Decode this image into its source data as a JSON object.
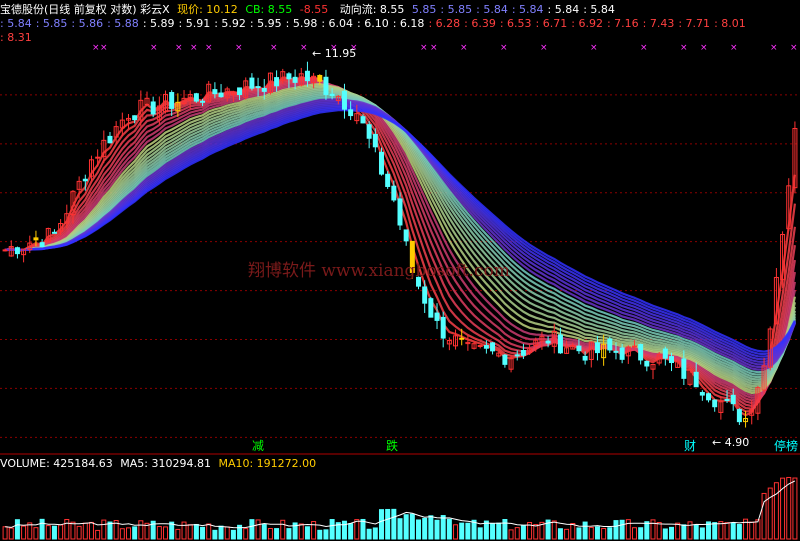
{
  "header": {
    "title": "宝德股份(日线 前复权 对数) 彩云X",
    "price_label": "现价: 10.12",
    "cb_label": "CB: 8.55",
    "dash_value": "8.55",
    "flow_label": "动向流: 8.55",
    "flow_values": [
      "5.85",
      "5.85",
      "5.84",
      "5.84",
      "5.84",
      "5.84"
    ],
    "row2_values": [
      "5.84",
      "5.85",
      "5.86",
      "5.88",
      "5.89",
      "5.91",
      "5.92",
      "5.95",
      "5.98",
      "6.04",
      "6.10",
      "6.18",
      "6.28",
      "6.39",
      "6.53",
      "6.71",
      "6.92",
      "7.16",
      "7.43",
      "7.71",
      "8.01"
    ],
    "row3_values": [
      "8.31"
    ]
  },
  "annotations": {
    "high_label": "11.95",
    "low_label": "4.90",
    "watermark": "翔博软件 www.xiangbosoft.com",
    "signals": [
      {
        "text": "减",
        "color": "#00ff00"
      },
      {
        "text": "跌",
        "color": "#00ff00"
      },
      {
        "text": "财",
        "color": "#00ffff"
      },
      {
        "text": "停榜",
        "color": "#00ffff"
      }
    ]
  },
  "volume_header": {
    "volume": "VOLUME: 425184.63",
    "ma5": "MA5: 310294.81",
    "ma10": "MA10: 191272.00"
  },
  "colors": {
    "up": "#ff3232",
    "down": "#54ffff",
    "yellow": "#ffcc00",
    "grid": "#8b0000",
    "cloud_red": "#ff4040",
    "cloud_blue": "#3030ff",
    "magenta": "#ff33ff"
  },
  "chart_data": {
    "type": "candlestick",
    "title": "宝德股份(日线 前复权 对数) 彩云X",
    "scale": "log",
    "grid": true,
    "price_anchors": [
      {
        "i": 0,
        "p": 7.6
      },
      {
        "i": 8,
        "p": 7.9
      },
      {
        "i": 14,
        "p": 9.5
      },
      {
        "i": 20,
        "p": 10.7
      },
      {
        "i": 28,
        "p": 11.0
      },
      {
        "i": 36,
        "p": 11.3
      },
      {
        "i": 42,
        "p": 11.5
      },
      {
        "i": 48,
        "p": 11.7
      },
      {
        "i": 53,
        "p": 11.3
      },
      {
        "i": 57,
        "p": 10.7
      },
      {
        "i": 63,
        "p": 8.6
      },
      {
        "i": 66,
        "p": 7.2
      },
      {
        "i": 70,
        "p": 6.3
      },
      {
        "i": 75,
        "p": 5.9
      },
      {
        "i": 82,
        "p": 5.85
      },
      {
        "i": 88,
        "p": 6.1
      },
      {
        "i": 94,
        "p": 5.9
      },
      {
        "i": 100,
        "p": 5.9
      },
      {
        "i": 106,
        "p": 5.8
      },
      {
        "i": 112,
        "p": 5.5
      },
      {
        "i": 116,
        "p": 5.2
      },
      {
        "i": 120,
        "p": 5.0
      },
      {
        "i": 123,
        "p": 5.7
      },
      {
        "i": 126,
        "p": 8.0
      },
      {
        "i": 128,
        "p": 10.12
      }
    ],
    "count": 129,
    "y_range": [
      4.6,
      12.6
    ],
    "volume": {
      "last": 425184.63,
      "ma5": 310294.81,
      "ma10": 191272.0
    }
  }
}
